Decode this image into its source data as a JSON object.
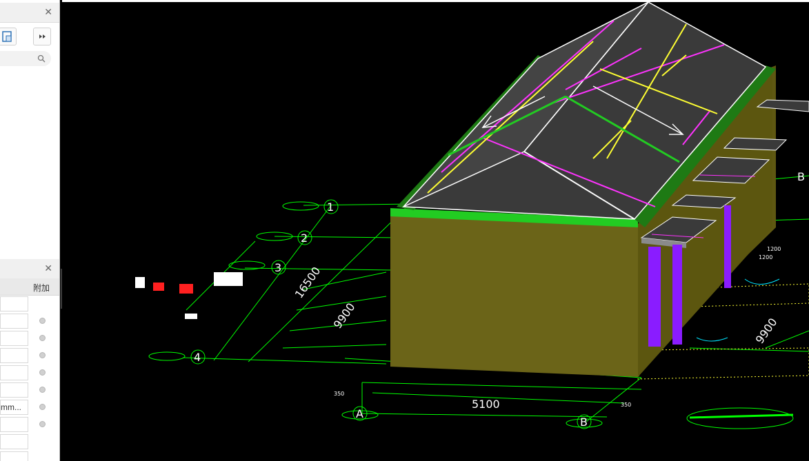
{
  "top_panel": {
    "close_icon": "close-icon"
  },
  "tools": {
    "left_icon": "floorplan-icon",
    "right_icon": "forward-icon"
  },
  "search": {
    "icon": "search-icon"
  },
  "props": {
    "column_header": "附加",
    "rows": [
      {
        "value": "",
        "has_dot": false
      },
      {
        "value": "",
        "has_dot": true
      },
      {
        "value": "",
        "has_dot": true
      },
      {
        "value": "",
        "has_dot": true
      },
      {
        "value": "",
        "has_dot": true
      },
      {
        "value": "",
        "has_dot": true
      },
      {
        "value": "mm...",
        "has_dot": true
      },
      {
        "value": "",
        "has_dot": true
      },
      {
        "value": "",
        "has_dot": false
      },
      {
        "value": "",
        "has_dot": false
      }
    ]
  },
  "cad": {
    "axis_numbers": [
      "1",
      "2",
      "3",
      "4"
    ],
    "axis_letters": [
      "A",
      "B",
      "B"
    ],
    "dims": [
      "16500",
      "9900",
      "9900",
      "5100",
      "1200",
      "1200",
      "350",
      "350"
    ]
  },
  "colors": {
    "wall": "#6b6418",
    "roof": "#333333",
    "green": "#1e7a14",
    "purple": "#8a1cff",
    "yellow": "#ffff33",
    "magenta": "#ff33ff",
    "grid": "#00ff00"
  }
}
